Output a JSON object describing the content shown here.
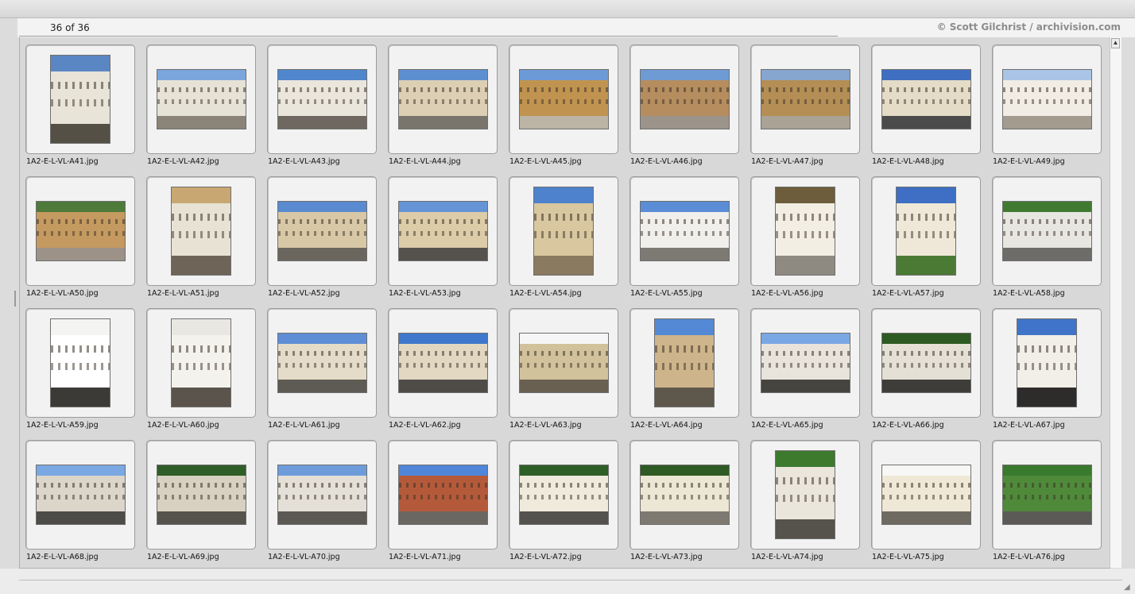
{
  "header": {
    "counter": "36 of 36",
    "copyright": "© Scott Gilchrist / archivision.com"
  },
  "scrollbar": {
    "up_icon": "▲"
  },
  "thumbnails": [
    {
      "filename": "1A2-E-L-VL-A41.jpg",
      "orientation": "portrait",
      "palette": {
        "sky": "#5b86c4",
        "building": "#e8e4d8",
        "ground": "#555046"
      }
    },
    {
      "filename": "1A2-E-L-VL-A42.jpg",
      "orientation": "landscape",
      "palette": {
        "sky": "#7aa6dd",
        "building": "#e6e2d6",
        "ground": "#8a8478"
      }
    },
    {
      "filename": "1A2-E-L-VL-A43.jpg",
      "orientation": "landscape",
      "palette": {
        "sky": "#4f86cc",
        "building": "#ebe6dc",
        "ground": "#6e6860"
      }
    },
    {
      "filename": "1A2-E-L-VL-A44.jpg",
      "orientation": "landscape",
      "palette": {
        "sky": "#5d8fd0",
        "building": "#dccfb4",
        "ground": "#7a756c"
      }
    },
    {
      "filename": "1A2-E-L-VL-A45.jpg",
      "orientation": "landscape",
      "palette": {
        "sky": "#6c9ad6",
        "building": "#c09450",
        "ground": "#bcb4a4"
      }
    },
    {
      "filename": "1A2-E-L-VL-A46.jpg",
      "orientation": "landscape",
      "palette": {
        "sky": "#6f9bd4",
        "building": "#b58d5e",
        "ground": "#9c948a"
      }
    },
    {
      "filename": "1A2-E-L-VL-A47.jpg",
      "orientation": "landscape",
      "palette": {
        "sky": "#86a6cf",
        "building": "#b48e54",
        "ground": "#aaa294"
      }
    },
    {
      "filename": "1A2-E-L-VL-A48.jpg",
      "orientation": "landscape",
      "palette": {
        "sky": "#3f6fc0",
        "building": "#e4dcc6",
        "ground": "#4b4b4b"
      }
    },
    {
      "filename": "1A2-E-L-VL-A49.jpg",
      "orientation": "landscape",
      "palette": {
        "sky": "#a9c4e6",
        "building": "#f1ede4",
        "ground": "#a39b8e"
      }
    },
    {
      "filename": "1A2-E-L-VL-A50.jpg",
      "orientation": "landscape",
      "palette": {
        "sky": "#4e7a3a",
        "building": "#c59a60",
        "ground": "#9c9288"
      }
    },
    {
      "filename": "1A2-E-L-VL-A51.jpg",
      "orientation": "portrait",
      "palette": {
        "sky": "#c8a772",
        "building": "#e8e2d4",
        "ground": "#6e6458"
      }
    },
    {
      "filename": "1A2-E-L-VL-A52.jpg",
      "orientation": "landscape",
      "palette": {
        "sky": "#5a8ad0",
        "building": "#d8c8a6",
        "ground": "#6a665e"
      }
    },
    {
      "filename": "1A2-E-L-VL-A53.jpg",
      "orientation": "landscape",
      "palette": {
        "sky": "#6594d6",
        "building": "#dccca8",
        "ground": "#55524e"
      }
    },
    {
      "filename": "1A2-E-L-VL-A54.jpg",
      "orientation": "portrait",
      "palette": {
        "sky": "#4e82cc",
        "building": "#d9c7a0",
        "ground": "#8a7a60"
      }
    },
    {
      "filename": "1A2-E-L-VL-A55.jpg",
      "orientation": "landscape",
      "palette": {
        "sky": "#5b8dd6",
        "building": "#f0efec",
        "ground": "#7d7a74"
      }
    },
    {
      "filename": "1A2-E-L-VL-A56.jpg",
      "orientation": "portrait",
      "palette": {
        "sky": "#6d5d3c",
        "building": "#f2eee4",
        "ground": "#8e8a82"
      }
    },
    {
      "filename": "1A2-E-L-VL-A57.jpg",
      "orientation": "portrait",
      "palette": {
        "sky": "#3e6fc4",
        "building": "#efe8d8",
        "ground": "#4b7a34"
      }
    },
    {
      "filename": "1A2-E-L-VL-A58.jpg",
      "orientation": "landscape",
      "palette": {
        "sky": "#3f7a30",
        "building": "#e8e6e0",
        "ground": "#6e6c68"
      }
    },
    {
      "filename": "1A2-E-L-VL-A59.jpg",
      "orientation": "portrait",
      "palette": {
        "sky": "#f4f4f2",
        "building": "#ffffff",
        "ground": "#3c3a36"
      }
    },
    {
      "filename": "1A2-E-L-VL-A60.jpg",
      "orientation": "portrait",
      "palette": {
        "sky": "#e9e7e2",
        "building": "#f4f2ec",
        "ground": "#5a544c"
      }
    },
    {
      "filename": "1A2-E-L-VL-A61.jpg",
      "orientation": "landscape",
      "palette": {
        "sky": "#5e8fd6",
        "building": "#e4dcc8",
        "ground": "#5e5a54"
      }
    },
    {
      "filename": "1A2-E-L-VL-A62.jpg",
      "orientation": "landscape",
      "palette": {
        "sky": "#3e78cc",
        "building": "#e2d8c2",
        "ground": "#4f4c48"
      }
    },
    {
      "filename": "1A2-E-L-VL-A63.jpg",
      "orientation": "landscape",
      "palette": {
        "sky": "#f6f6f6",
        "building": "#d2c29c",
        "ground": "#6a6052"
      }
    },
    {
      "filename": "1A2-E-L-VL-A64.jpg",
      "orientation": "portrait",
      "palette": {
        "sky": "#5389d4",
        "building": "#cdb48a",
        "ground": "#5e574c"
      }
    },
    {
      "filename": "1A2-E-L-VL-A65.jpg",
      "orientation": "landscape",
      "palette": {
        "sky": "#7aa8e4",
        "building": "#e8e4dc",
        "ground": "#46443f"
      }
    },
    {
      "filename": "1A2-E-L-VL-A66.jpg",
      "orientation": "landscape",
      "palette": {
        "sky": "#2d5a22",
        "building": "#e4e0d6",
        "ground": "#3f3d3a"
      }
    },
    {
      "filename": "1A2-E-L-VL-A67.jpg",
      "orientation": "portrait",
      "palette": {
        "sky": "#3f74c8",
        "building": "#f1efe8",
        "ground": "#2e2c2a"
      }
    },
    {
      "filename": "1A2-E-L-VL-A68.jpg",
      "orientation": "landscape",
      "palette": {
        "sky": "#7aa8e2",
        "building": "#dcd6ca",
        "ground": "#4e4c48"
      }
    },
    {
      "filename": "1A2-E-L-VL-A69.jpg",
      "orientation": "landscape",
      "palette": {
        "sky": "#2f5e28",
        "building": "#d8d0c0",
        "ground": "#56524c"
      }
    },
    {
      "filename": "1A2-E-L-VL-A70.jpg",
      "orientation": "landscape",
      "palette": {
        "sky": "#6e9cda",
        "building": "#e4e0d8",
        "ground": "#5c5954"
      }
    },
    {
      "filename": "1A2-E-L-VL-A71.jpg",
      "orientation": "landscape",
      "palette": {
        "sky": "#4f86d8",
        "building": "#b45a3a",
        "ground": "#6a6660"
      }
    },
    {
      "filename": "1A2-E-L-VL-A72.jpg",
      "orientation": "landscape",
      "palette": {
        "sky": "#2e5f26",
        "building": "#efeadc",
        "ground": "#54524e"
      }
    },
    {
      "filename": "1A2-E-L-VL-A73.jpg",
      "orientation": "landscape",
      "palette": {
        "sky": "#2e5a24",
        "building": "#ece6d4",
        "ground": "#7e7a72"
      }
    },
    {
      "filename": "1A2-E-L-VL-A74.jpg",
      "orientation": "portrait",
      "palette": {
        "sky": "#3d7a2e",
        "building": "#eae6dc",
        "ground": "#56524c"
      }
    },
    {
      "filename": "1A2-E-L-VL-A75.jpg",
      "orientation": "landscape",
      "palette": {
        "sky": "#f7f7f5",
        "building": "#efe8d6",
        "ground": "#6e6a62"
      }
    },
    {
      "filename": "1A2-E-L-VL-A76.jpg",
      "orientation": "landscape",
      "palette": {
        "sky": "#3a7a2e",
        "building": "#4f8a3a",
        "ground": "#5c5a56"
      }
    }
  ]
}
